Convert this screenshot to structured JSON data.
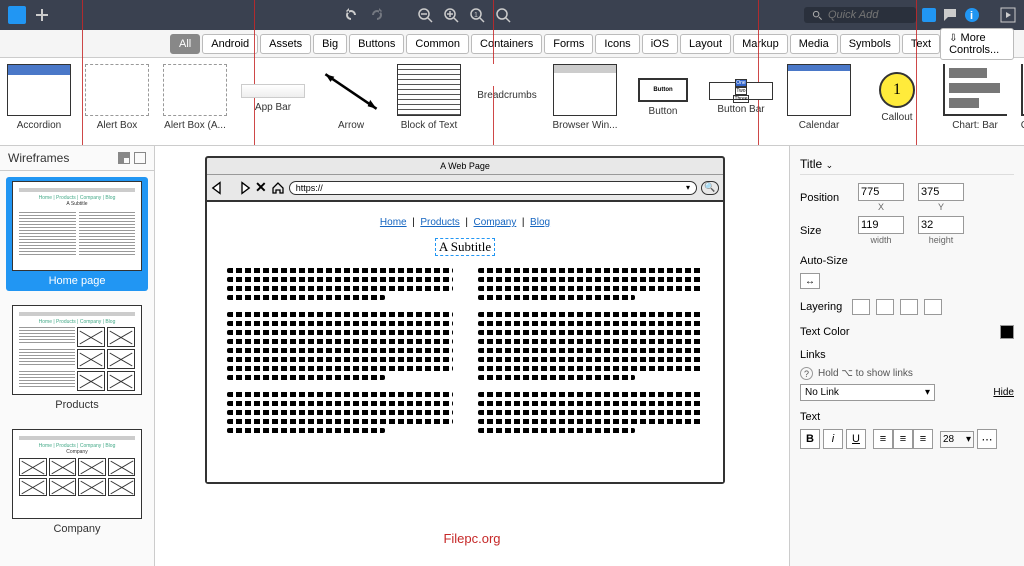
{
  "topbar": {
    "quickadd_placeholder": "Quick Add"
  },
  "filters": {
    "tabs": [
      "All",
      "Android",
      "Assets",
      "Big",
      "Buttons",
      "Common",
      "Containers",
      "Forms",
      "Icons",
      "iOS",
      "Layout",
      "Markup",
      "Media",
      "Symbols",
      "Text"
    ],
    "active": "All",
    "more": "More Controls..."
  },
  "library": [
    {
      "label": "Accordion"
    },
    {
      "label": "Alert Box"
    },
    {
      "label": "Alert Box (A..."
    },
    {
      "label": "App Bar"
    },
    {
      "label": "Arrow"
    },
    {
      "label": "Block of Text"
    },
    {
      "label": "Breadcrumbs"
    },
    {
      "label": "Browser Win..."
    },
    {
      "label": "Button",
      "text": "Button"
    },
    {
      "label": "Button Bar"
    },
    {
      "label": "Calendar"
    },
    {
      "label": "Callout",
      "text": "1"
    },
    {
      "label": "Chart: Bar"
    },
    {
      "label": "Chart: Column"
    }
  ],
  "sidebar": {
    "title": "Wireframes",
    "items": [
      {
        "label": "Home page",
        "selected": true
      },
      {
        "label": "Products",
        "selected": false
      },
      {
        "label": "Company",
        "selected": false
      }
    ]
  },
  "mockup": {
    "browser_title": "A Web Page",
    "url": "https://",
    "nav": [
      "Home",
      "Products",
      "Company",
      "Blog"
    ],
    "subtitle": "A Subtitle"
  },
  "props": {
    "title": "Title",
    "position_label": "Position",
    "size_label": "Size",
    "x": "775",
    "y": "375",
    "xl": "X",
    "yl": "Y",
    "w": "119",
    "h": "32",
    "wl": "width",
    "hl": "height",
    "autosize": "Auto-Size",
    "layering": "Layering",
    "textcolor": "Text Color",
    "links": "Links",
    "links_hint": "Hold ⌥ to show links",
    "link_value": "No Link",
    "hide": "Hide",
    "text": "Text",
    "fontsize": "28"
  },
  "watermark": "Filepc.org"
}
